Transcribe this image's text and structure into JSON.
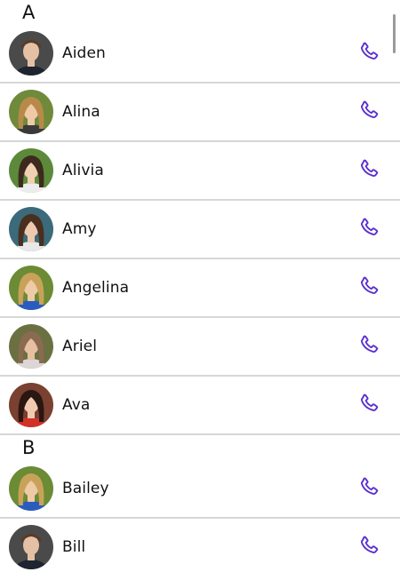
{
  "accent_color": "#5b2fd0",
  "call_icon": "phone-icon",
  "sections": [
    {
      "letter": "A",
      "contacts": [
        {
          "name": "Aiden",
          "avatar": {
            "bg": "#4a4a4a",
            "skin": "#e4c0a4",
            "hair": "#5a3a26",
            "shirt": "#1e2430",
            "gender": "m"
          }
        },
        {
          "name": "Alina",
          "avatar": {
            "bg": "#6f8a3a",
            "skin": "#f0c9a8",
            "hair": "#b78a4a",
            "shirt": "#3a3a3a",
            "gender": "f"
          }
        },
        {
          "name": "Alivia",
          "avatar": {
            "bg": "#5c8a3a",
            "skin": "#f1cfb2",
            "hair": "#3d2a1e",
            "shirt": "#ededed",
            "gender": "f"
          }
        },
        {
          "name": "Amy",
          "avatar": {
            "bg": "#3b6a7a",
            "skin": "#efc9ad",
            "hair": "#4a2e1e",
            "shirt": "#e8e8e8",
            "gender": "f"
          }
        },
        {
          "name": "Angelina",
          "avatar": {
            "bg": "#6b8b34",
            "skin": "#efcaa6",
            "hair": "#c9a25a",
            "shirt": "#2a5cc0",
            "gender": "f"
          }
        },
        {
          "name": "Ariel",
          "avatar": {
            "bg": "#6a7040",
            "skin": "#e7c0a2",
            "hair": "#8a6a50",
            "shirt": "#dcd6d6",
            "gender": "f"
          }
        },
        {
          "name": "Ava",
          "avatar": {
            "bg": "#7a4030",
            "skin": "#f0cbb0",
            "hair": "#2a1612",
            "shirt": "#d0322a",
            "gender": "f"
          }
        }
      ]
    },
    {
      "letter": "B",
      "contacts": [
        {
          "name": "Bailey",
          "avatar": {
            "bg": "#6b8b34",
            "skin": "#efcaa6",
            "hair": "#c9a25a",
            "shirt": "#2a5cc0",
            "gender": "f"
          }
        },
        {
          "name": "Bill",
          "avatar": {
            "bg": "#4a4a4a",
            "skin": "#e4c0a4",
            "hair": "#5a3a26",
            "shirt": "#1e2430",
            "gender": "m"
          }
        }
      ]
    }
  ]
}
